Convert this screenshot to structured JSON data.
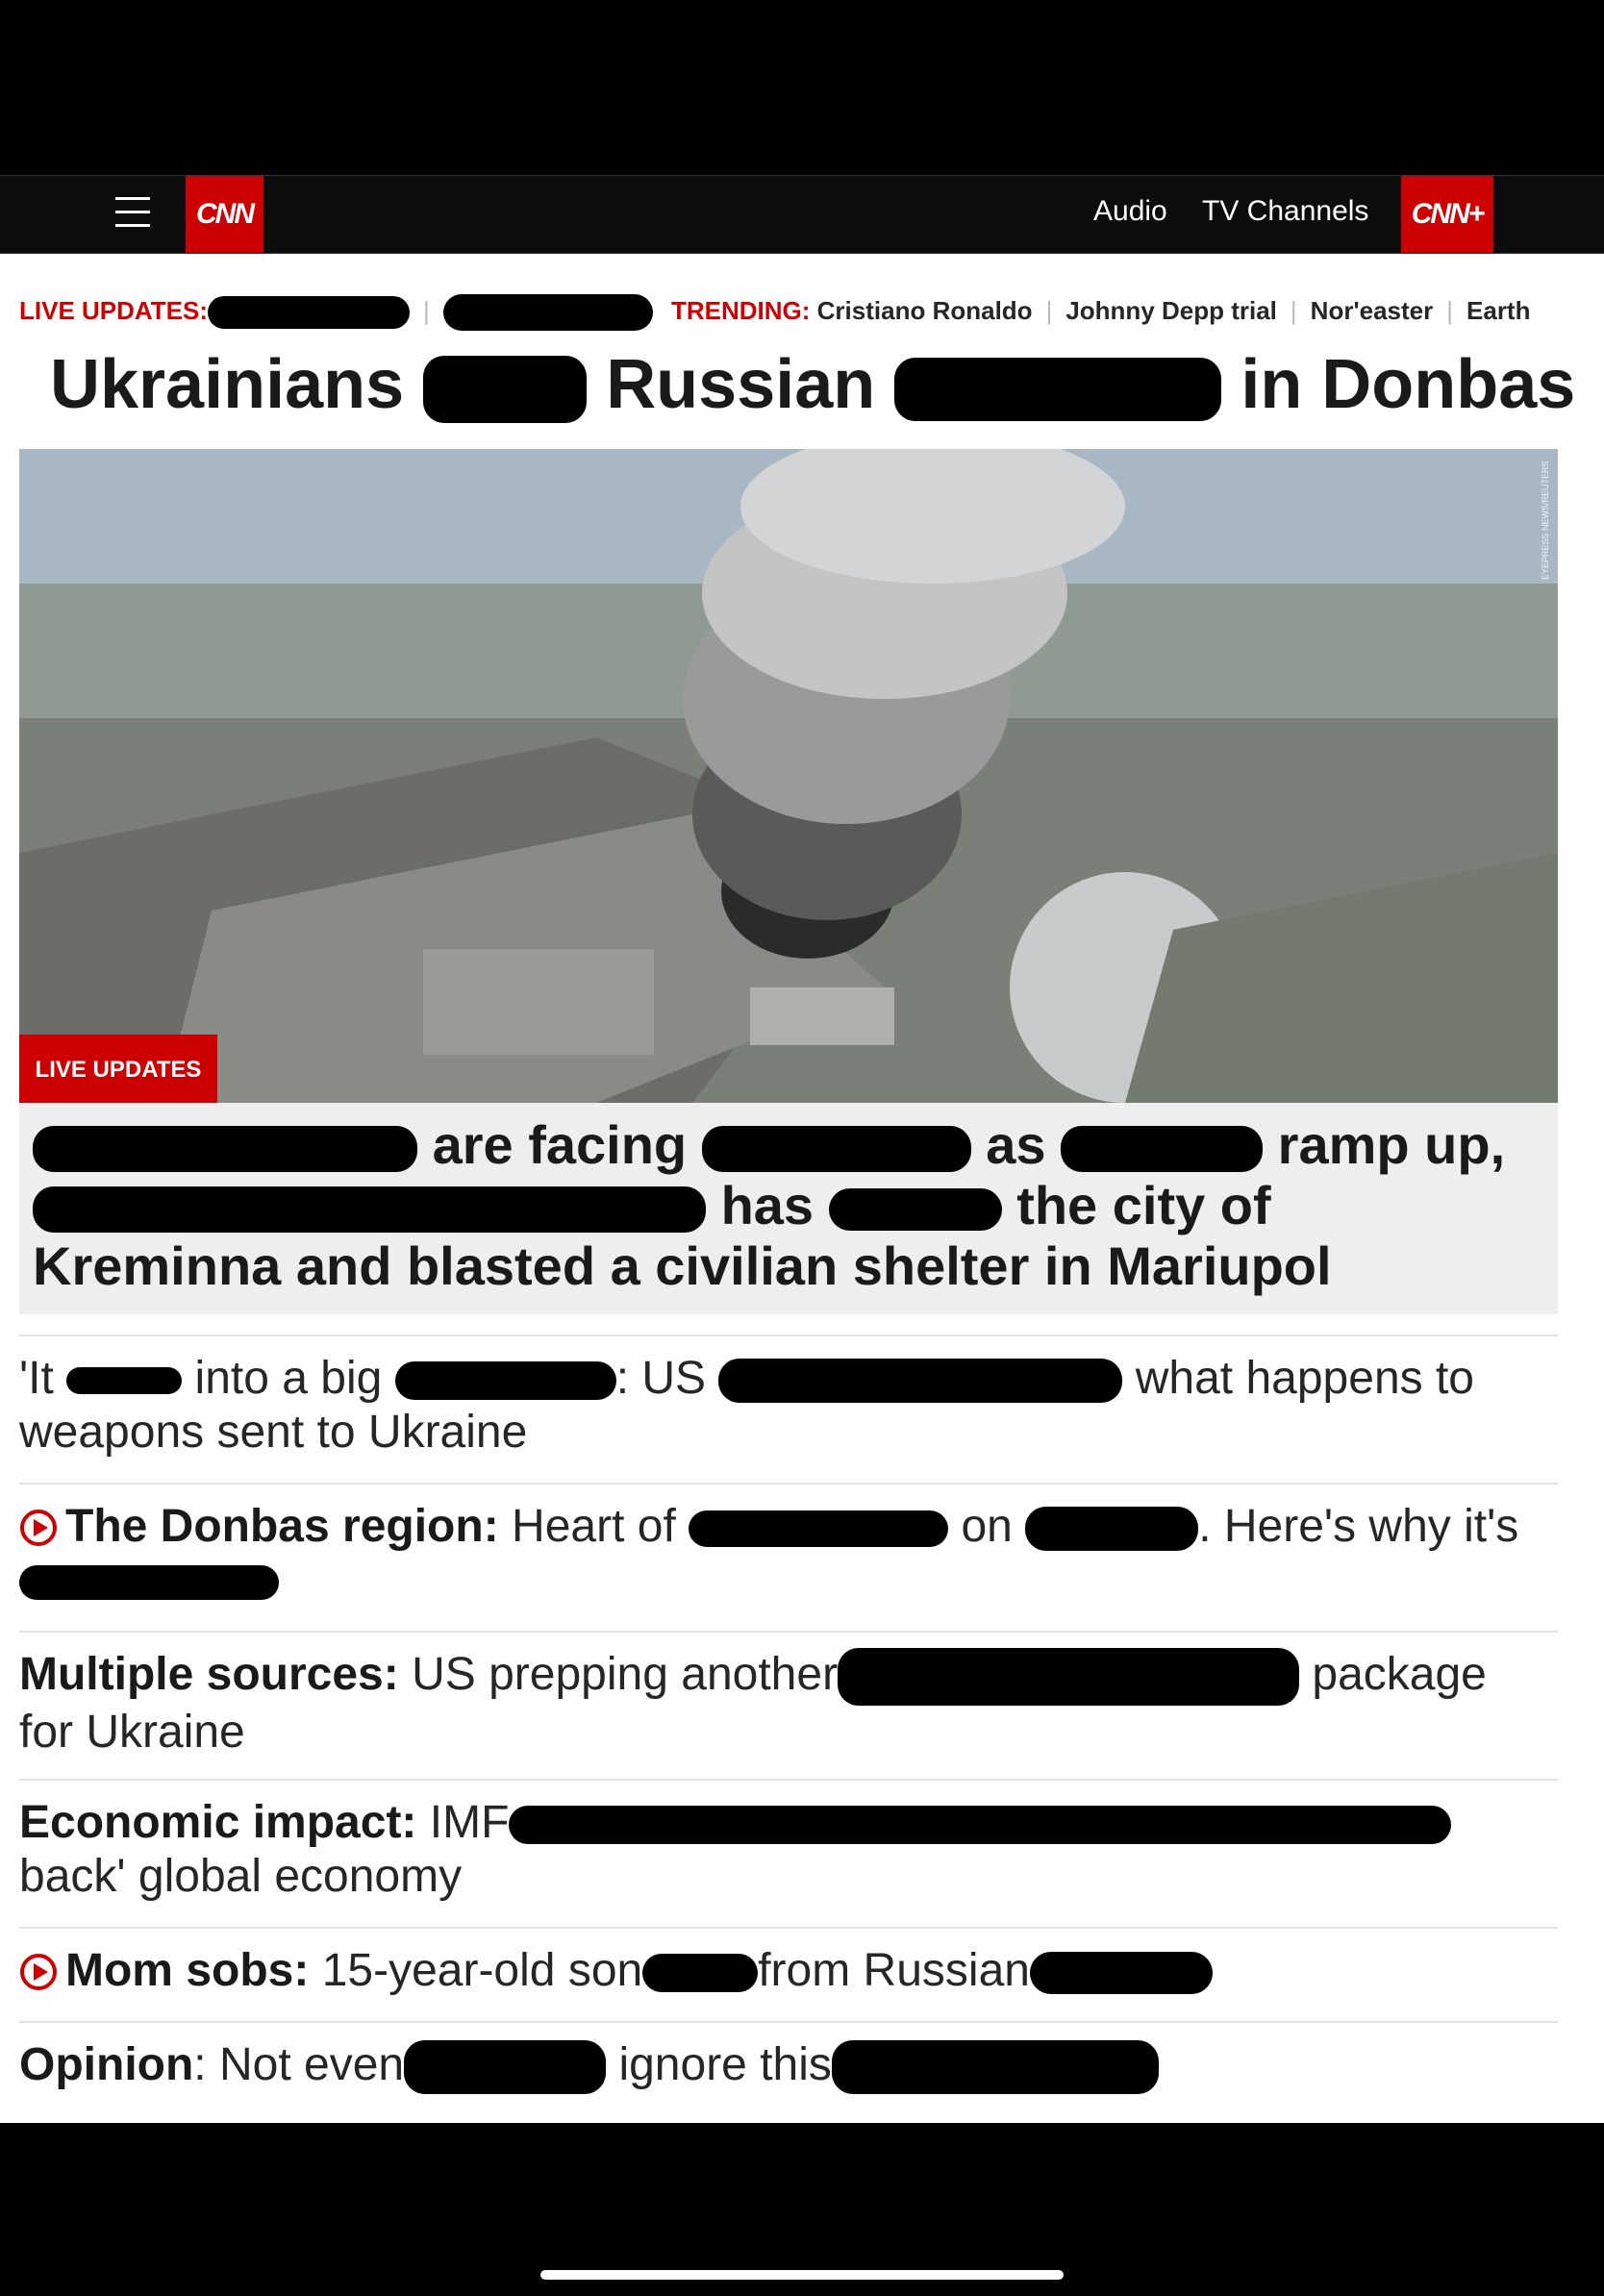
{
  "nav": {
    "logo": "CNN",
    "audio": "Audio",
    "tv_channels": "TV Channels",
    "cnn_plus": "CNN+"
  },
  "ticker": {
    "live_label": "LIVE UPDATES:",
    "trending_label": "TRENDING:",
    "trending": [
      "Cristiano Ronaldo",
      "Johnny Depp trial",
      "Nor'easter",
      "Earth"
    ]
  },
  "headline": {
    "part1": "Ukrainians",
    "part2": "Russian",
    "part3": "in Donbas"
  },
  "hero": {
    "badge": "LIVE UPDATES",
    "credit": "EYEPRESS NEWS/REUTERS"
  },
  "caption": {
    "t1": "are facing",
    "t2": "as",
    "t3": "ramp up,",
    "t4": "has",
    "t5": "the city of",
    "t6": "Kreminna and blasted a civilian shelter in Mariupol"
  },
  "stories": [
    {
      "a": "'It",
      "b": "into a big",
      "c": ": US",
      "d": "what happens to",
      "e": "weapons sent to Ukraine"
    },
    {
      "bold": "The Donbas region:",
      "a": "Heart of",
      "b": "on",
      "c": ". Here's why it's"
    },
    {
      "bold": "Multiple sources:",
      "a": "US prepping another",
      "b": "package",
      "c": "for Ukraine"
    },
    {
      "bold": "Economic impact:",
      "a": "IMF",
      "b": "back' global economy"
    },
    {
      "bold": "Mom sobs:",
      "a": "15-year-old son",
      "b": "from Russian"
    },
    {
      "bold": "Opinion",
      "a": ": Not even",
      "b": "ignore this"
    }
  ]
}
